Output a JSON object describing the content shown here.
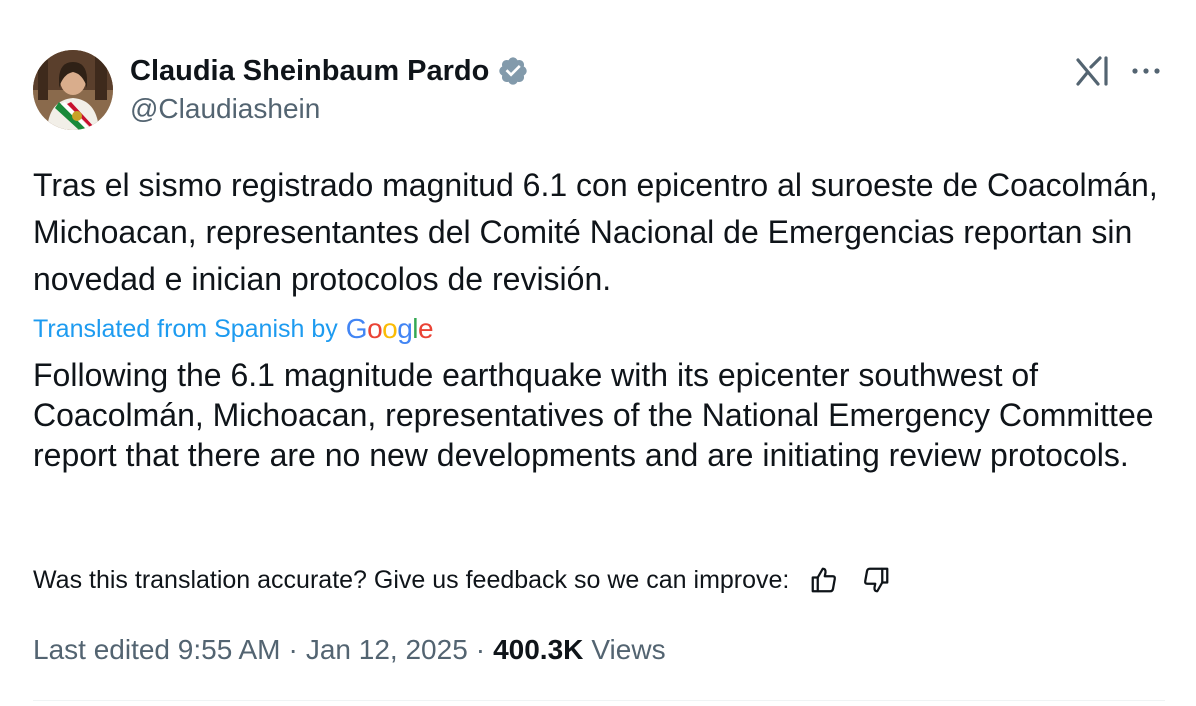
{
  "author": {
    "display_name": "Claudia Sheinbaum Pardo",
    "handle": "@Claudiashein",
    "verified_icon": "verified-badge-icon"
  },
  "header_actions": {
    "grok_icon": "grok-icon",
    "more_icon": "more-options-icon"
  },
  "tweet": {
    "original_text": "Tras el sismo registrado magnitud 6.1 con epicentro al suroeste de Coacolmán, Michoacan, representantes del Comité Nacional de Emergencias reportan sin novedad e inician protocolos de revisión.",
    "translated_label": "Translated from Spanish by",
    "google_letters": [
      "G",
      "o",
      "o",
      "g",
      "l",
      "e"
    ],
    "google_colors": [
      "#4285F4",
      "#EA4335",
      "#FBBC05",
      "#4285F4",
      "#34A853",
      "#EA4335"
    ],
    "translation_text": "Following the 6.1 magnitude earthquake with its epicenter southwest of Coacolmán, Michoacan, representatives of the National Emergency Committee report that there are no new developments and are initiating review protocols."
  },
  "feedback": {
    "prompt": "Was this translation accurate? Give us feedback so we can improve:",
    "thumbs_up_icon": "thumbs-up-icon",
    "thumbs_down_icon": "thumbs-down-icon"
  },
  "meta": {
    "edited_label": "Last edited 9:55 AM",
    "separator": "·",
    "date": "Jan 12, 2025",
    "views_count": "400.3K",
    "views_label": "Views"
  },
  "colors": {
    "link_blue": "#1d9bf0",
    "secondary_text": "#536471",
    "primary_text": "#0f1419",
    "verified_gray": "#829aab"
  }
}
